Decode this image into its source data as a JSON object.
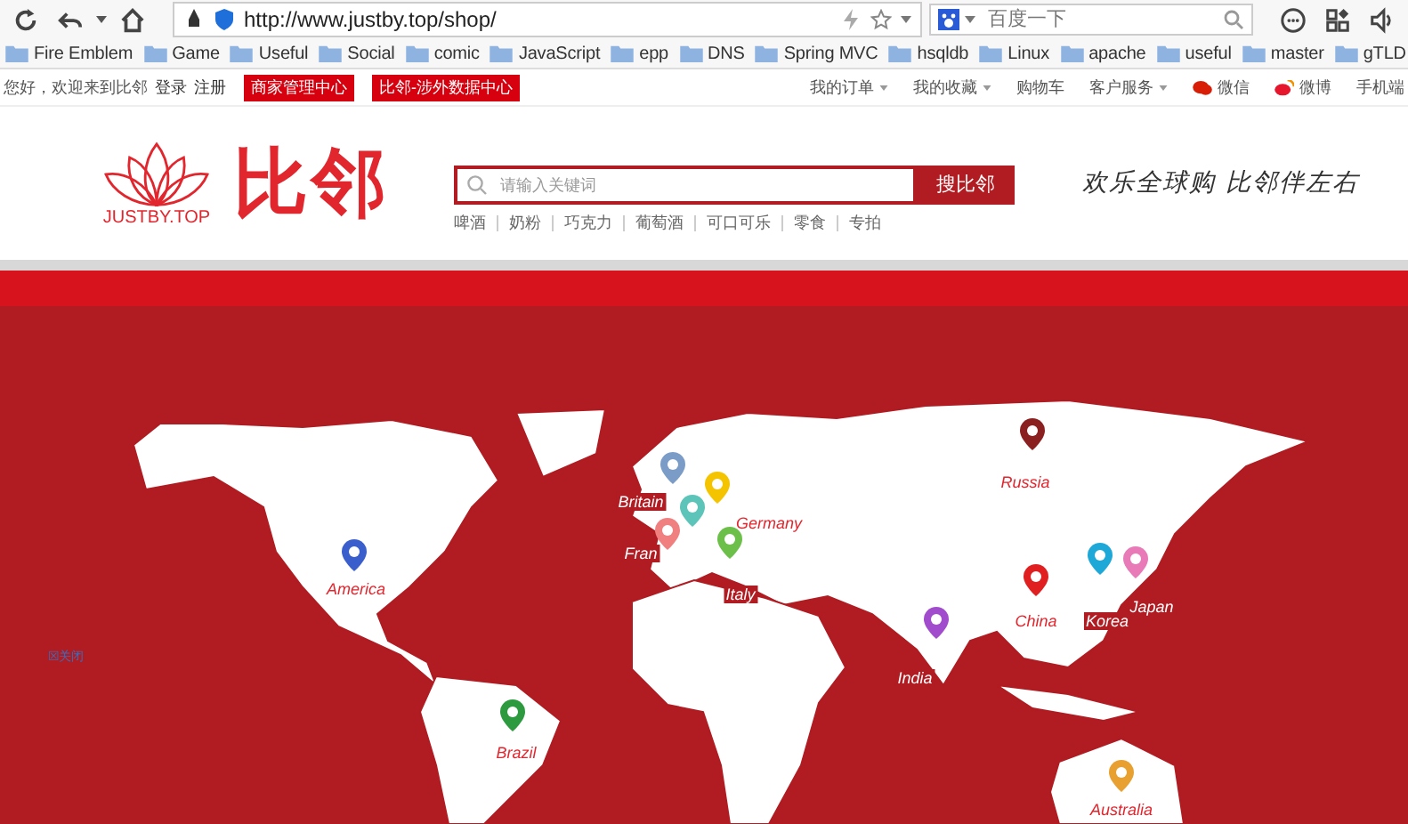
{
  "browser": {
    "url": "http://www.justby.top/shop/",
    "search_placeholder": "百度一下"
  },
  "bookmarks": [
    "Fire Emblem",
    "Game",
    "Useful",
    "Social",
    "comic",
    "JavaScript",
    "epp",
    "DNS",
    "Spring MVC",
    "hsqldb",
    "Linux",
    "apache",
    "useful",
    "master",
    "gTLD"
  ],
  "top_bar": {
    "greeting": "您好，欢迎来到比邻",
    "login": "登录",
    "register": "注册",
    "badges": [
      "商家管理中心",
      "比邻-涉外数据中心"
    ],
    "menu": [
      {
        "label": "我的订单",
        "dropdown": true
      },
      {
        "label": "我的收藏",
        "dropdown": true
      },
      {
        "label": "购物车",
        "dropdown": false
      },
      {
        "label": "客户服务",
        "dropdown": true
      },
      {
        "label": "微信",
        "dropdown": false
      },
      {
        "label": "微博",
        "dropdown": false
      },
      {
        "label": "手机端",
        "dropdown": false
      }
    ]
  },
  "header": {
    "logo_text": "JUSTBY.TOP",
    "brand": "比邻",
    "search_placeholder": "请输入关键词",
    "search_button": "搜比邻",
    "keywords": [
      "啤酒",
      "奶粉",
      "巧克力",
      "葡萄酒",
      "可口可乐",
      "零食",
      "专拍"
    ],
    "slogan": "欢乐全球购 比邻伴左右"
  },
  "map": {
    "close_label": "☒关闭",
    "pins": [
      {
        "label": "Russia",
        "color": "#8b2020"
      },
      {
        "label": "Britain",
        "color": "#7a9cc6"
      },
      {
        "label": "Germany",
        "color": "#f5c400"
      },
      {
        "color": "#5cc4b8"
      },
      {
        "label": "Fran",
        "color": "#f08080"
      },
      {
        "label": "Italy",
        "color": "#6cc04a"
      },
      {
        "label": "America",
        "color": "#3a5fcd"
      },
      {
        "label": "China",
        "color": "#e02020"
      },
      {
        "label": "Korea",
        "color": "#1ea8d8"
      },
      {
        "label": "Japan",
        "color": "#e87ab8"
      },
      {
        "label": "India",
        "color": "#a04ccc"
      },
      {
        "label": "Brazil",
        "color": "#2e9a40"
      },
      {
        "label": "Australia",
        "color": "#e8a030"
      }
    ]
  }
}
